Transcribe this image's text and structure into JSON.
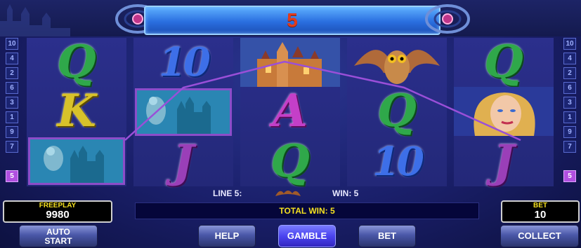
{
  "win_display": "5",
  "line_numbers_left": [
    "10",
    "4",
    "2",
    "6",
    "3",
    "1",
    "9",
    "7",
    "5"
  ],
  "line_numbers_right": [
    "10",
    "4",
    "2",
    "6",
    "3",
    "1",
    "9",
    "7",
    "5"
  ],
  "active_line": "5",
  "reels": [
    [
      "Q",
      "K",
      "owl-castle"
    ],
    [
      "10",
      "owl-castle",
      "J"
    ],
    [
      "castle",
      "A",
      "Q"
    ],
    [
      "owl",
      "Q",
      "10"
    ],
    [
      "Q",
      "woman",
      "J"
    ]
  ],
  "info": {
    "line_label": "LINE 5:",
    "win_label": "WIN: 5",
    "total_win": "TOTAL WIN: 5"
  },
  "freeplay": {
    "label": "FREEPLAY",
    "value": "9980"
  },
  "bet_box": {
    "label": "BET",
    "value": "10"
  },
  "buttons": {
    "auto_start_line1": "AUTO",
    "auto_start_line2": "START",
    "help": "HELP",
    "gamble": "GAMBLE",
    "bet": "BET",
    "collect": "COLLECT"
  },
  "colors": {
    "accent": "#f4e020",
    "highlight": "#8c4dc9",
    "win_number": "#e23b1b"
  }
}
